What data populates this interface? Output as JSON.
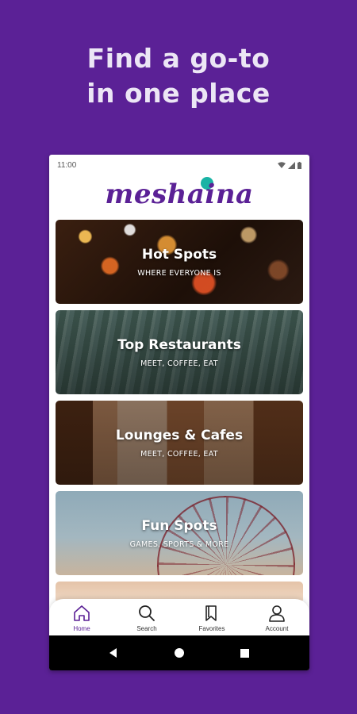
{
  "promo": {
    "line1": "Find a go-to",
    "line2": "in one place"
  },
  "status_bar": {
    "time": "11:00"
  },
  "app": {
    "logo": "meshaina",
    "brand_color": "#5b2196",
    "accent_color": "#19b3a5"
  },
  "categories": [
    {
      "title": "Hot Spots",
      "subtitle": "WHERE EVERYONE IS"
    },
    {
      "title": "Top Restaurants",
      "subtitle": "MEET, COFFEE, EAT"
    },
    {
      "title": "Lounges & Cafes",
      "subtitle": "MEET, COFFEE, EAT"
    },
    {
      "title": "Fun Spots",
      "subtitle": "GAMES, SPORTS & MORE"
    }
  ],
  "bottom_nav": [
    {
      "label": "Home",
      "icon": "home-icon",
      "active": true
    },
    {
      "label": "Search",
      "icon": "search-icon",
      "active": false
    },
    {
      "label": "Favorites",
      "icon": "bookmark-icon",
      "active": false
    },
    {
      "label": "Account",
      "icon": "user-icon",
      "active": false
    }
  ],
  "system_nav": {
    "back": "back-icon",
    "home": "home-circle-icon",
    "recents": "recents-icon"
  }
}
